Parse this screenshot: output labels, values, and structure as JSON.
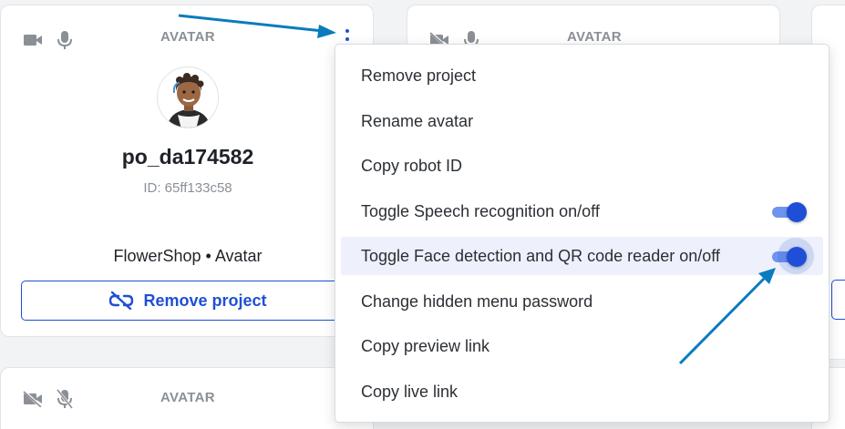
{
  "cards": [
    {
      "type_label": "AVATAR",
      "name": "po_da174582",
      "id_text": "ID: 65ff133c58",
      "project_line": "FlowerShop • Avatar",
      "remove_button": "Remove project",
      "camera": "video-camera-icon",
      "mic": "microphone-icon"
    },
    {
      "type_label": "AVATAR",
      "camera": "video-camera-off-icon",
      "mic": "microphone-icon"
    },
    {
      "type_label": "AVATAR",
      "camera": "video-camera-off-icon",
      "mic": "microphone-off-icon"
    }
  ],
  "menu": {
    "items": [
      {
        "label": "Remove project"
      },
      {
        "label": "Rename avatar"
      },
      {
        "label": "Copy robot ID"
      },
      {
        "label": "Toggle Speech recognition on/off",
        "toggle": true,
        "toggle_on": true
      },
      {
        "label": "Toggle Face detection and QR code reader on/off",
        "toggle": true,
        "toggle_on": true,
        "highlighted": true
      },
      {
        "label": "Change hidden menu password"
      },
      {
        "label": "Copy preview link"
      },
      {
        "label": "Copy live link"
      }
    ]
  },
  "colors": {
    "accent": "#1f4fd6",
    "annotation_arrow": "#0a7bbd",
    "muted_text": "#8b9097",
    "card_border": "#e1e4e8"
  },
  "icons": [
    "video-camera-icon",
    "video-camera-off-icon",
    "microphone-icon",
    "microphone-off-icon",
    "kebab-menu-icon",
    "unlink-icon",
    "avatar-image"
  ]
}
